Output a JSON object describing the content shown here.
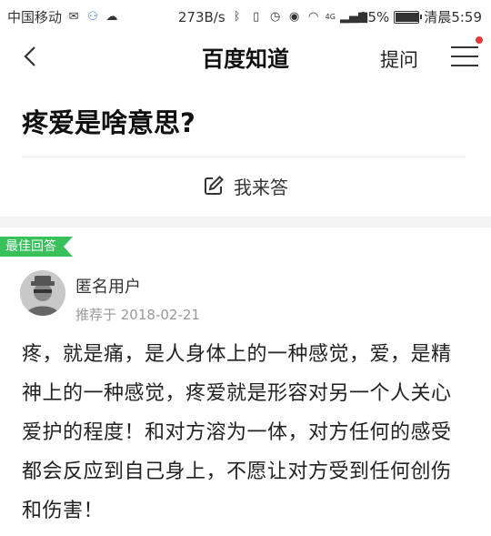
{
  "status_bar": {
    "carrier": "中国移动",
    "speed": "273B/s",
    "battery_percent": "95%",
    "battery_level": 0.95,
    "time": "清晨5:59",
    "network": "4G"
  },
  "nav": {
    "title": "百度知道",
    "ask_label": "提问"
  },
  "question": {
    "title": "疼爱是啥意思?",
    "answer_button": "我来答"
  },
  "answer": {
    "badge": "最佳回答",
    "user_name": "匿名用户",
    "recommend_date": "推荐于 2018-02-21",
    "body": "疼，就是痛，是人身体上的一种感觉，爱，是精神上的一种感觉，疼爱就是形容对另一个人关心爱护的程度！和对方溶为一体，对方任何的感受都会反应到自己身上，不愿让对方受到任何创伤和伤害！"
  },
  "colors": {
    "accent_green": "#38c05a",
    "notify_red": "#e4393c"
  }
}
